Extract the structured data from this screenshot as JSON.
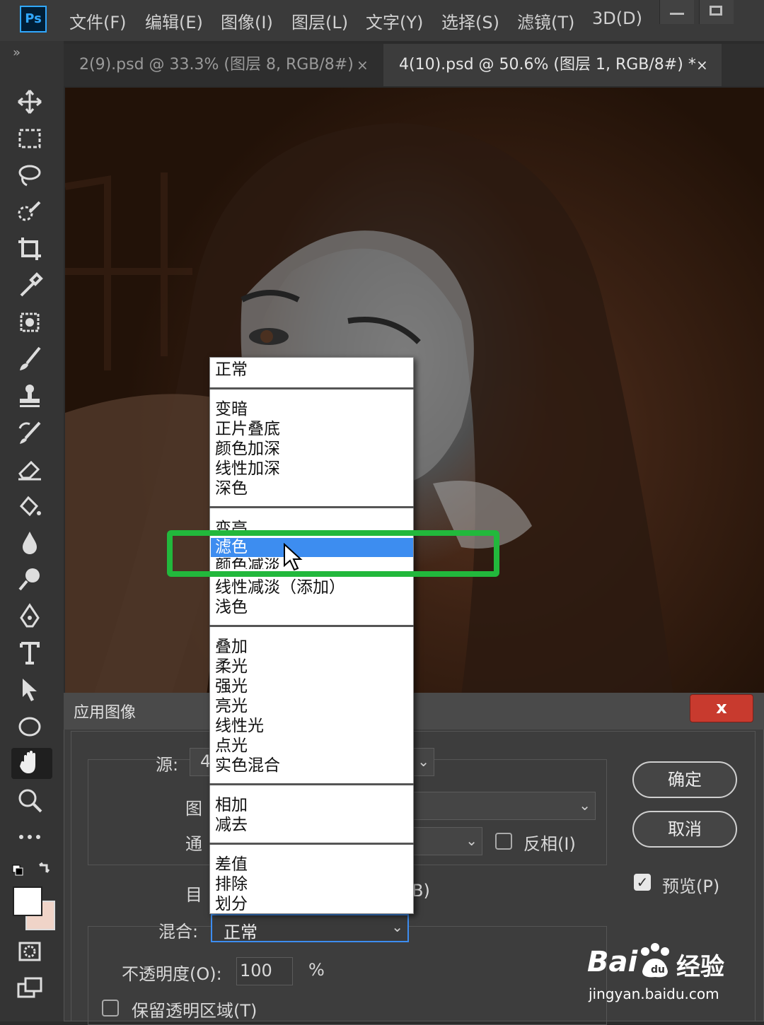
{
  "app": {
    "logo": "Ps"
  },
  "menubar": {
    "items": [
      "文件(F)",
      "编辑(E)",
      "图像(I)",
      "图层(L)",
      "文字(Y)",
      "选择(S)",
      "滤镜(T)",
      "3D(D)"
    ]
  },
  "tabs": [
    {
      "label": "2(9).psd @ 33.3% (图层 8, RGB/8#)",
      "close": "×"
    },
    {
      "label": "4(10).psd @ 50.6% (图层 1, RGB/8#) *",
      "close": "×"
    }
  ],
  "toolbar": {
    "collapse_glyph": "»"
  },
  "dialog": {
    "title": "应用图像",
    "close": "x",
    "source_label": "源:",
    "layer_label": "图",
    "channel_label": "通",
    "invert_label": "反相(I)",
    "target_label": "目",
    "target_suffix": "B)",
    "blend_label": "混合:",
    "blend_value": "正常",
    "opacity_label": "不透明度(O):",
    "opacity_value": "100",
    "opacity_unit": "%",
    "preserve_label": "保留透明区域(T)",
    "ok": "确定",
    "cancel": "取消",
    "preview_label": "预览(P)",
    "preview_checked": true,
    "source_select_fragment": "4"
  },
  "blend_dropdown": {
    "groups": [
      [
        "正常"
      ],
      [
        "变暗",
        "正片叠底",
        "颜色加深",
        "线性加深",
        "深色"
      ],
      [
        "变亮",
        "滤色",
        "颜色减淡",
        "线性减淡（添加）",
        "浅色"
      ],
      [
        "叠加",
        "柔光",
        "强光",
        "亮光",
        "线性光",
        "点光",
        "实色混合"
      ],
      [
        "相加",
        "减去"
      ],
      [
        "差值",
        "排除",
        "划分"
      ]
    ],
    "highlighted": "滤色"
  },
  "watermark": {
    "brand": "Bai",
    "brand2": "经验",
    "url": "jingyan.baidu.com"
  },
  "colors": {
    "highlight": "#3d8df0",
    "annotation": "#22b83c",
    "close_red": "#c83a2e"
  }
}
